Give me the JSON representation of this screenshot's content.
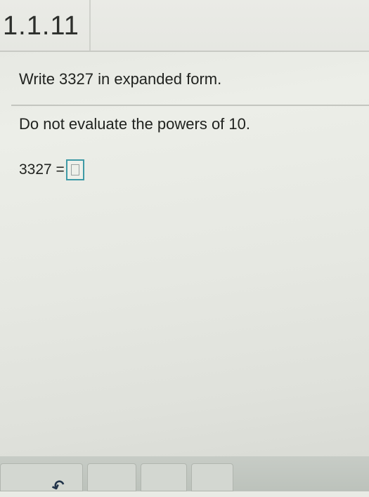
{
  "header": {
    "problem_number": "1.1.11"
  },
  "question": {
    "instruction": "Write 3327 in expanded form.",
    "sub_instruction": "Do not evaluate the powers of 10.",
    "equation_label": "3327 ="
  },
  "answer": {
    "value": ""
  },
  "footer": {
    "undo_icon": "undo-icon"
  },
  "colors": {
    "answer_box_border": "#3f9aa6",
    "undo_icon": "#22344a"
  }
}
